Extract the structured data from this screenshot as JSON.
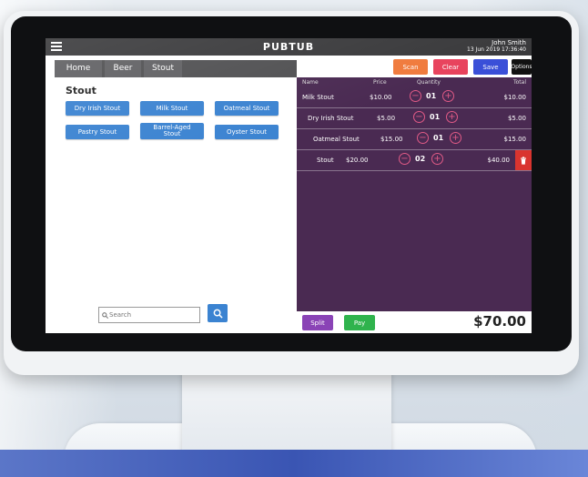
{
  "app": {
    "brand": "PUBTUB",
    "user_name": "John Smith",
    "datetime": "13 Jun 2019 17:36:40"
  },
  "tabs": [
    {
      "label": "Home"
    },
    {
      "label": "Beer"
    },
    {
      "label": "Stout"
    }
  ],
  "category": {
    "title": "Stout",
    "products": [
      {
        "label": "Dry Irish Stout"
      },
      {
        "label": "Milk Stout"
      },
      {
        "label": "Oatmeal Stout"
      },
      {
        "label": "Pastry Stout"
      },
      {
        "label": "Barrel-Aged Stout"
      },
      {
        "label": "Oyster Stout"
      }
    ]
  },
  "search": {
    "placeholder": "Search",
    "icon": "search-icon"
  },
  "actions": {
    "scan": "Scan",
    "clear": "Clear",
    "save": "Save",
    "options": "Options",
    "split": "Split",
    "pay": "Pay"
  },
  "order": {
    "columns": {
      "name": "Name",
      "price": "Price",
      "quantity": "Quantity",
      "total": "Total"
    },
    "rows": [
      {
        "name": "Milk Stout",
        "price": "$10.00",
        "qty": "01",
        "total": "$10.00"
      },
      {
        "name": "Dry Irish Stout",
        "price": "$5.00",
        "qty": "01",
        "total": "$5.00"
      },
      {
        "name": "Oatmeal Stout",
        "price": "$15.00",
        "qty": "01",
        "total": "$15.00"
      },
      {
        "name": "Stout",
        "price": "$20.00",
        "qty": "02",
        "total": "$40.00"
      }
    ],
    "grand_total": "$70.00"
  },
  "colors": {
    "accent_blue": "#3b83d1",
    "scan": "#f07a3c",
    "clear": "#e8425c",
    "save": "#3a4fd8",
    "options": "#111111",
    "split": "#8a43b6",
    "pay": "#2fb34d",
    "order_panel": "#4a2a52",
    "delete": "#d9342f"
  }
}
